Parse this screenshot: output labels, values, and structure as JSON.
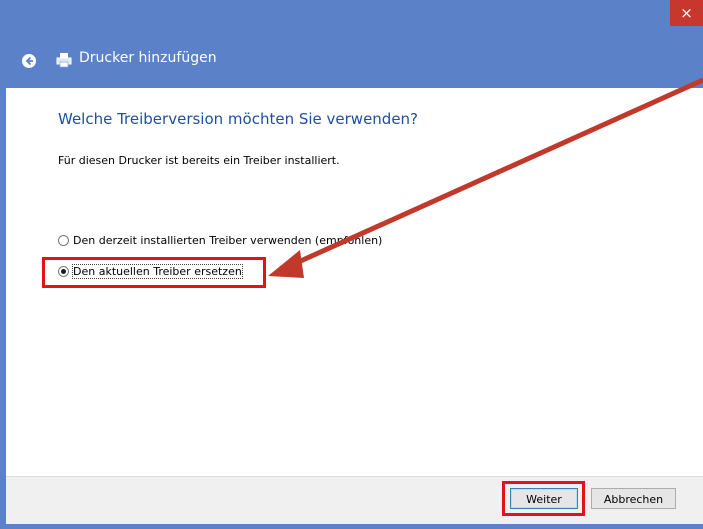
{
  "window": {
    "title": "Drucker hinzufügen",
    "close_glyph": "×"
  },
  "main": {
    "heading": "Welche Treiberversion möchten Sie verwenden?",
    "description": "Für diesen Drucker ist bereits ein Treiber installiert.",
    "options": [
      {
        "label": "Den derzeit installierten Treiber verwenden (empfohlen)",
        "checked": false
      },
      {
        "label": "Den aktuellen Treiber ersetzen",
        "checked": true
      }
    ]
  },
  "footer": {
    "next_label": "Weiter",
    "cancel_label": "Abbrechen"
  },
  "colors": {
    "titlebar": "#5b82c8",
    "close": "#c7372e",
    "heading": "#1f4fa0",
    "highlight": "#e0121c",
    "arrow": "#c0392b"
  },
  "icons": [
    "back-arrow-icon",
    "printer-icon",
    "close-icon"
  ]
}
